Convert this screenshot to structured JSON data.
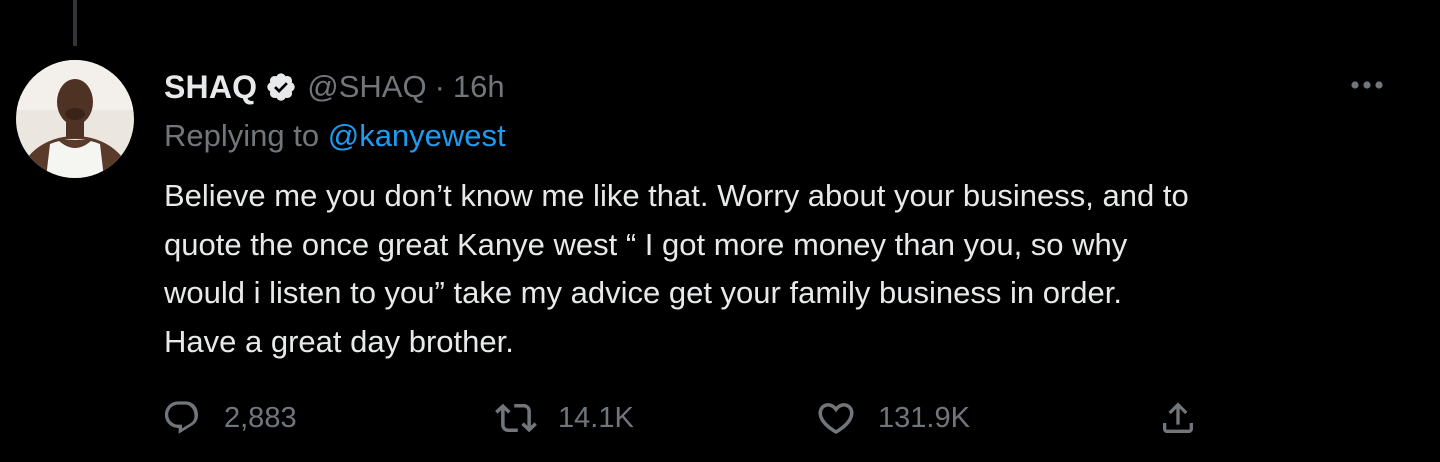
{
  "tweet": {
    "display_name": "SHAQ",
    "handle": "@SHAQ",
    "separator": "·",
    "timestamp": "16h",
    "replying_prefix": "Replying to ",
    "replying_to": "@kanyewest",
    "text": "Believe me you don’t know me like that. Worry about your business, and to\nquote the once great Kanye west “ I got more money than you, so why\nwould i listen to you”  take my advice get your family business in order.\nHave a great day brother."
  },
  "actions": {
    "replies": "2,883",
    "retweets": "14.1K",
    "likes": "131.9K"
  },
  "icons": {
    "verified": "verified-badge-icon",
    "more": "more-horizontal-icon",
    "reply": "reply-bubble-icon",
    "retweet": "retweet-icon",
    "like": "heart-icon",
    "share": "share-upload-icon"
  },
  "colors": {
    "background": "#000000",
    "primary_text": "#e7e9ea",
    "secondary_text": "#71767b",
    "link": "#1d9bf0",
    "thread_line": "#333639"
  }
}
